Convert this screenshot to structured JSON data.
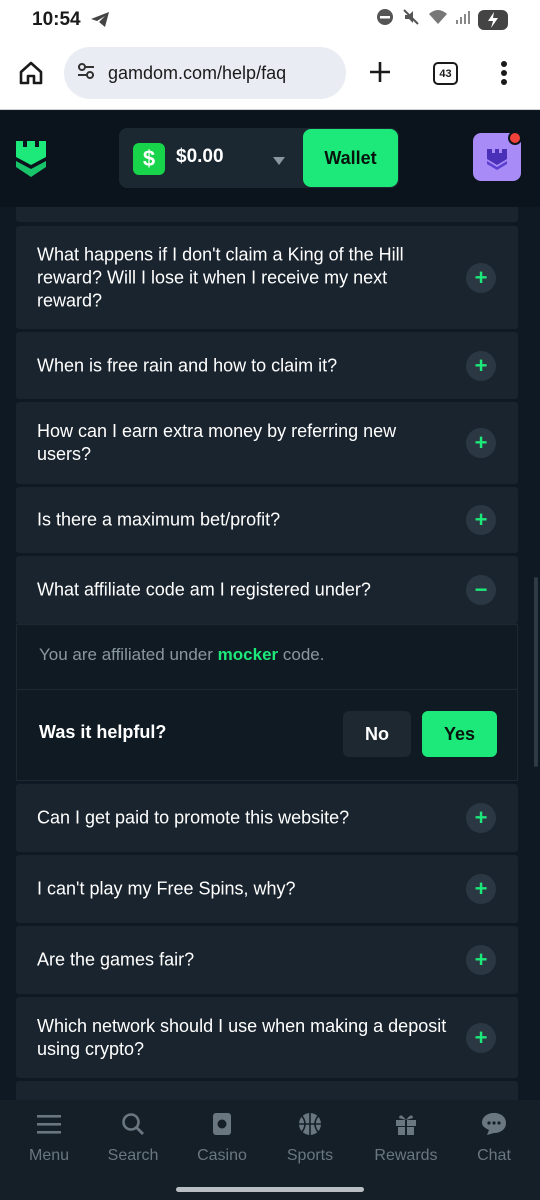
{
  "status_bar": {
    "time": "10:54"
  },
  "browser": {
    "url": "gamdom.com/help/faq",
    "tab_count": "43"
  },
  "header": {
    "balance": "$0.00",
    "currency_symbol": "$",
    "wallet_label": "Wallet"
  },
  "faq": {
    "items": [
      {
        "question": "What happens if I don't claim a King of the Hill reward? Will I lose it when I receive my next reward?",
        "expanded": false
      },
      {
        "question": "When is free rain and how to claim it?",
        "expanded": false
      },
      {
        "question": "How can I earn extra money by referring new users?",
        "expanded": false
      },
      {
        "question": "Is there a maximum bet/profit?",
        "expanded": false
      },
      {
        "question": "What affiliate code am I registered under?",
        "expanded": true
      },
      {
        "question": "Can I get paid to promote this website?",
        "expanded": false
      },
      {
        "question": "I can't play my Free Spins, why?",
        "expanded": false
      },
      {
        "question": "Are the games fair?",
        "expanded": false
      },
      {
        "question": "Which network should I use when making a deposit using crypto?",
        "expanded": false
      }
    ],
    "answer": {
      "prefix": "You are affiliated under ",
      "code": "mocker",
      "suffix": " code."
    },
    "helpful": {
      "label": "Was it helpful?",
      "no": "No",
      "yes": "Yes"
    },
    "toggle_plus": "+",
    "toggle_minus": "−"
  },
  "bottom_nav": {
    "items": [
      {
        "label": "Menu",
        "icon": "hamburger-icon"
      },
      {
        "label": "Search",
        "icon": "search-icon"
      },
      {
        "label": "Casino",
        "icon": "casino-icon"
      },
      {
        "label": "Sports",
        "icon": "basketball-icon"
      },
      {
        "label": "Rewards",
        "icon": "gift-icon"
      },
      {
        "label": "Chat",
        "icon": "chat-icon"
      }
    ]
  },
  "colors": {
    "accent": "#1de87a",
    "background": "#0f1923",
    "card": "#1a242e",
    "muted": "#6b7780"
  }
}
